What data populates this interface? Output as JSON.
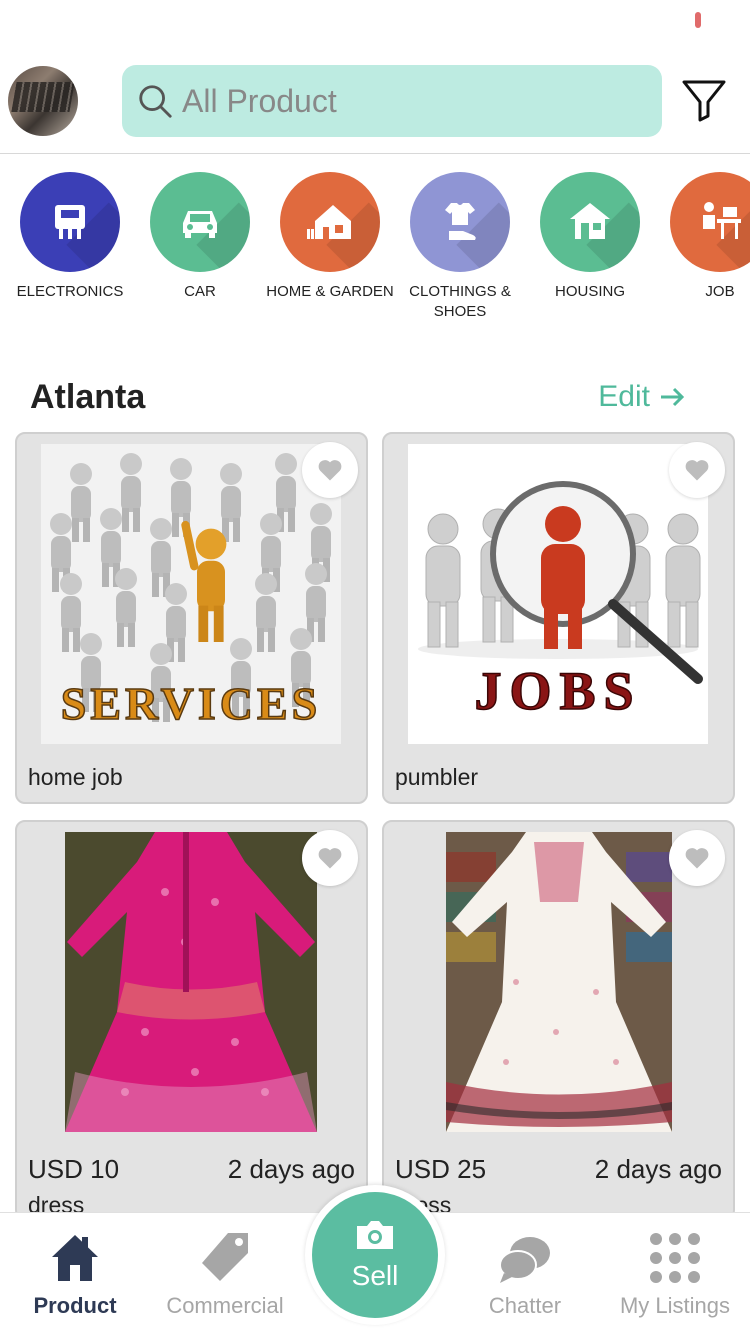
{
  "search": {
    "placeholder": "All Product"
  },
  "categories": [
    {
      "label": "ELECTRONICS",
      "color": "#3b3fb6",
      "icon": "electronics-icon"
    },
    {
      "label": "CAR",
      "color": "#5bbd92",
      "icon": "car-icon"
    },
    {
      "label": "HOME & GARDEN",
      "color": "#e06a3e",
      "icon": "home-garden-icon"
    },
    {
      "label": "CLOTHINGS & SHOES",
      "color": "#8f95d4",
      "icon": "clothing-icon"
    },
    {
      "label": "HOUSING",
      "color": "#5bbd92",
      "icon": "housing-icon"
    },
    {
      "label": "JOB",
      "color": "#e06a3e",
      "icon": "job-icon"
    }
  ],
  "section": {
    "city": "Atlanta",
    "edit_label": "Edit"
  },
  "listings": [
    {
      "title": "home job",
      "image": "services-image"
    },
    {
      "title": "pumbler",
      "image": "jobs-image"
    },
    {
      "price": "USD 10",
      "ago": "2 days ago",
      "subtitle": "dress",
      "image": "pink-dress-image"
    },
    {
      "price": "USD 25",
      "ago": "2 days ago",
      "subtitle": "dress",
      "image": "white-dress-image"
    }
  ],
  "image_text": {
    "services": "SERVICES",
    "jobs": "JOBS"
  },
  "nav": {
    "product": "Product",
    "commercial": "Commercial",
    "sell": "Sell",
    "chatter": "Chatter",
    "my_listings": "My Listings"
  },
  "colors": {
    "accent": "#5bbda1",
    "search_bg": "#bdebe1",
    "active_nav": "#2e3a55"
  }
}
